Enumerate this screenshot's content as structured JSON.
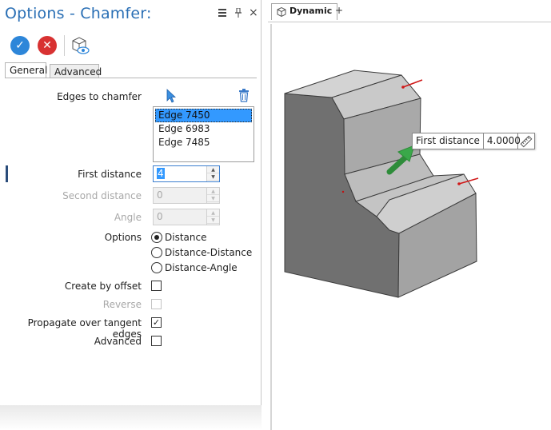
{
  "panel": {
    "title": "Options - Chamfer:",
    "menu_icon": "menu-icon",
    "pin_icon": "pin-icon",
    "close_icon": "close-icon",
    "close_glyph": "×",
    "ok_glyph": "✓",
    "cancel_glyph": "✕"
  },
  "tabs": {
    "general": "General",
    "advanced": "Advanced"
  },
  "form": {
    "edges_label": "Edges to chamfer",
    "edges": [
      "Edge 7450",
      "Edge 6983",
      "Edge 7485"
    ],
    "selected_edge": "Edge 7450",
    "first_distance_label": "First distance",
    "first_distance_value": "4",
    "second_distance_label": "Second distance",
    "second_distance_value": "0",
    "angle_label": "Angle",
    "angle_value": "0",
    "options_label": "Options",
    "options": [
      "Distance",
      "Distance-Distance",
      "Distance-Angle"
    ],
    "selected_option": "Distance",
    "create_by_offset_label": "Create by offset",
    "create_by_offset_checked": false,
    "reverse_label": "Reverse",
    "reverse_checked": false,
    "propagate_label": "Propagate over tangent edges",
    "propagate_checked": true,
    "advanced_label": "Advanced",
    "advanced_checked": false,
    "check_glyph": "✓"
  },
  "viewport": {
    "tab_label": "Dynamic",
    "add_tab": "+",
    "tooltip_label": "First distance",
    "tooltip_value": "4.0000"
  },
  "colors": {
    "accent": "#2a6fb5",
    "ok": "#2d86d9",
    "cancel": "#d83232",
    "selection": "#3399ff",
    "part_dark": "#707070",
    "part_light": "#bcbcbc",
    "handle": "#3aa84a",
    "edge_marker": "#d01818"
  }
}
